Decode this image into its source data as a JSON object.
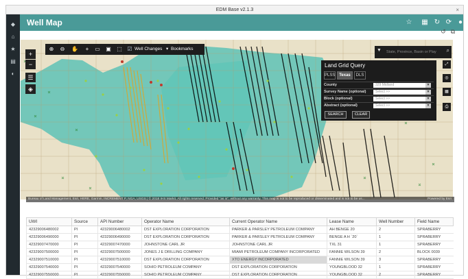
{
  "window": {
    "title": "EDM Base v2.1.3",
    "close": "×"
  },
  "header": {
    "title": "Well Map"
  },
  "map": {
    "toolbar": {
      "well_changes": "Well Changes",
      "bookmarks": "Bookmarks"
    },
    "search_placeholder": "State, Province, Basin or Play",
    "attribution": "Bureau of Land Management, Esri, HERE, Garmin, INCREMENT P, NGA, USGS | © 2018 IHS Markit. All rights reserved. Provided \"as is\", without any warranty. This map is not to be reproduced or disseminated and is not to be us...",
    "powered_by": "Powered by Esri"
  },
  "land_grid_query": {
    "title": "Land Grid Query",
    "tabs": [
      "PLSS",
      "Texas",
      "DLS"
    ],
    "active_tab": "Texas",
    "fields": [
      {
        "label": "County",
        "value": "329 Midland"
      },
      {
        "label": "Survey Name (optional)",
        "value": "Select >>"
      },
      {
        "label": "Block (optional)",
        "value": "Select >>"
      },
      {
        "label": "Abstract (optional)",
        "value": "Select >>"
      }
    ],
    "search": "SEARCH",
    "clear": "CLEAR"
  },
  "table": {
    "columns": [
      "UWI",
      "Source",
      "API Number",
      "Operator Name",
      "Current Operator Name",
      "Lease Name",
      "Well Number",
      "Field Name"
    ],
    "rows": [
      [
        "42329006480002",
        "PI",
        "42329006480002",
        "DST EXPLORATION CORPORATION",
        "PARKER & PARSLEY PETROLEUM COMPANY",
        "AH BENGE 20",
        "2",
        "SPRABERRY"
      ],
      [
        "42329006490000",
        "PI",
        "42329006490000",
        "DST EXPLORATION CORPORATION",
        "PARKER & PARSLEY PETROLEUM COMPANY",
        "BENGE A H `20`",
        "1",
        "SPRABERRY"
      ],
      [
        "42329007470000",
        "PI",
        "42329007470000",
        "JOHNSTONE CARL JR",
        "JOHNSTONE CARL JR",
        "TXL 31",
        "1",
        "SPRABERRY"
      ],
      [
        "42329007500000",
        "PI",
        "42329007500000",
        "JONES J E DRILLING COMPANY",
        "MIAMI PETROLEUM COMPANY INCORPORATED",
        "FANNIE WILSON 39",
        "2",
        "BLOCK 0039"
      ],
      [
        "42329007510000",
        "PI",
        "42329007510000",
        "DST EXPLORATION CORPORATION",
        "XTO ENERGY INCORPORATED",
        "FANNIE WILSON 39",
        "3",
        "SPRABERRY"
      ],
      [
        "42329007540000",
        "PI",
        "42329007540000",
        "SOHIO PETROLEUM COMPANY",
        "DST EXPLORATION CORPORATION",
        "YOUNGBLOOD 32",
        "1",
        "SPRABERRY"
      ],
      [
        "42329007550000",
        "PI",
        "42329007550000",
        "SOHIO PETROLEUM COMPANY",
        "DST EXPLORATION CORPORATION",
        "YOUNGBLOOD 32",
        "2",
        "SPRABERRY"
      ]
    ]
  }
}
